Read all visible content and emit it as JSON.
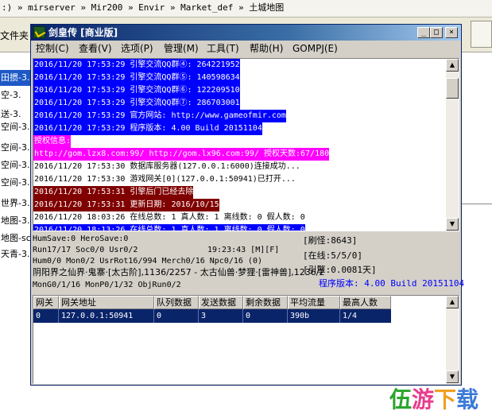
{
  "explorer": {
    "address_path": ":) » mirserver » Mir200 » Envir » Market_def » 土城地图",
    "toolbar_label": "文件夹",
    "side_items": [
      "田掼-3.",
      "空-3.",
      "送-3.",
      "空间-3.",
      "空间-3.",
      "空间-3.",
      "空间-3.",
      "世界-3.",
      "地图-3.",
      "地图-sc",
      "天青-3."
    ]
  },
  "window": {
    "title": "剑皇传 [商业版]",
    "buttons": {
      "minimize": "_",
      "maximize": "□",
      "close": "×"
    }
  },
  "menu": [
    {
      "label": "控制(C)"
    },
    {
      "label": "查看(V)"
    },
    {
      "label": "选项(P)"
    },
    {
      "label": "管理(M)"
    },
    {
      "label": "工具(T)"
    },
    {
      "label": "帮助(H)"
    },
    {
      "label": "GOMPJ(E)"
    }
  ],
  "log": {
    "colors": {
      "blue": "#0000ff",
      "magenta": "#ff00ff",
      "maroon": "#800000"
    },
    "lines": [
      {
        "text": "2016/11/20 17:53:29 引擎交流QQ群④: 264221952",
        "style": "blue"
      },
      {
        "text": "2016/11/20 17:53:29 引擎交流QQ群⑤: 140598634",
        "style": "blue"
      },
      {
        "text": "2016/11/20 17:53:29 引擎交流QQ群⑥: 122209510",
        "style": "blue"
      },
      {
        "text": "2016/11/20 17:53:29 引擎交流QQ群⑦: 286703001",
        "style": "blue"
      },
      {
        "text": "2016/11/20 17:53:29 官方网站: http://www.gameofmir.com",
        "style": "blue"
      },
      {
        "text": "2016/11/20 17:53:29 程序版本: 4.00 Build 20151104",
        "style": "blue"
      },
      {
        "text": "授权信息:",
        "style": "magenta"
      },
      {
        "text": "http://gom.lzx8.com:99/ http://gom.lx96.com:99/ 授权天数:67/180",
        "style": "magenta"
      },
      {
        "text": "2016/11/20 17:53:30 数据库服务器(127.0.0.1:6000)连接成功...",
        "style": "plain"
      },
      {
        "text": "2016/11/20 17:53:30 游戏网关[0](127.0.0.1:50941)已打开...",
        "style": "plain"
      },
      {
        "text": "2016/11/20 17:53:31 引擎后门已经去除",
        "style": "maroon"
      },
      {
        "text": "2016/11/20 17:53:31 更新日期: 2016/10/15",
        "style": "maroon"
      },
      {
        "text": "2016/11/20 18:03:26 在线总数: 1 真人数: 1 离线数: 0 假人数: 0",
        "style": "plain"
      },
      {
        "text": "2016/11/20 18:13:26 在线总数: 1 真人数: 1 离线数: 0 假人数: 0",
        "style": "blue"
      }
    ]
  },
  "status": {
    "line1": "HumSave:0 HeroSave:0",
    "line2": "Run17/17 Soc0/0 Usr0/2",
    "time": "19:23:43 [M][F]",
    "line3": "Hum0/0 Mon0/2 UsrRot16/994 Merch0/16 Npc0/16 (0)",
    "line4": "阴阳界之仙界·鬼寨·[太古阶],1136/2257 - 太古仙兽·梦狸·[雷神兽],1236/2",
    "line5": "MonG0/1/16 MonP0/1/32 ObjRun0/2",
    "right1": "[刷怪:8643]",
    "right2": "[在线:5/5/0]",
    "right3": "[引擎:0.0081天]",
    "version": "程序版本: 4.00 Build 20151104"
  },
  "table": {
    "headers": [
      "网关",
      "网关地址",
      "队列数据",
      "发送数据",
      "剩余数据",
      "平均流量",
      "最高人数"
    ],
    "rows": [
      [
        "0",
        "127.0.0.1:50941",
        "0",
        "3",
        "0",
        "390b",
        "1/4"
      ]
    ]
  },
  "watermark": {
    "text": "伍游下载",
    "colors": [
      "#2aa52a",
      "#e83c8c",
      "#f0a020",
      "#3c7ad8"
    ]
  }
}
